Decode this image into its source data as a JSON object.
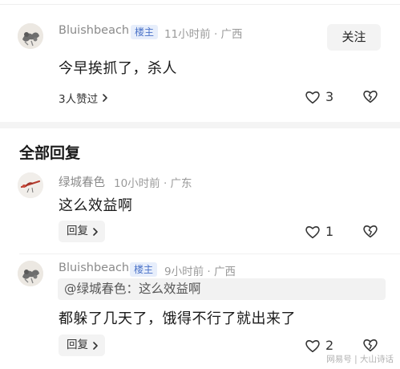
{
  "post": {
    "username": "Bluishbeach",
    "badge": "楼主",
    "time_location": "11小时前 · 广西",
    "follow_label": "关注",
    "content": "今早挨抓了，杀人",
    "likes_summary": "3人赞过",
    "like_count": "3"
  },
  "replies_section": {
    "title": "全部回复"
  },
  "replies": [
    {
      "username": "绿城春色",
      "time_location": "10小时前 · 广东",
      "content": "这么效益啊",
      "reply_label": "回复",
      "like_count": "1"
    },
    {
      "username": "Bluishbeach",
      "badge": "楼主",
      "time_location": "9小时前 · 广西",
      "quote": "@绿城春色：这么效益啊",
      "content": "都躲了几天了，饿得不行了就出来了",
      "reply_label": "回复",
      "like_count": "2"
    }
  ],
  "watermark": "网易号 | 大山诗话",
  "icons": {
    "chevron": "chevron-right-icon",
    "like": "heart-icon",
    "dislike": "broken-heart-icon"
  },
  "colors": {
    "badge_text": "#4a72c8",
    "badge_bg": "#e7eefb",
    "meta_gray": "#9a9a9a"
  }
}
